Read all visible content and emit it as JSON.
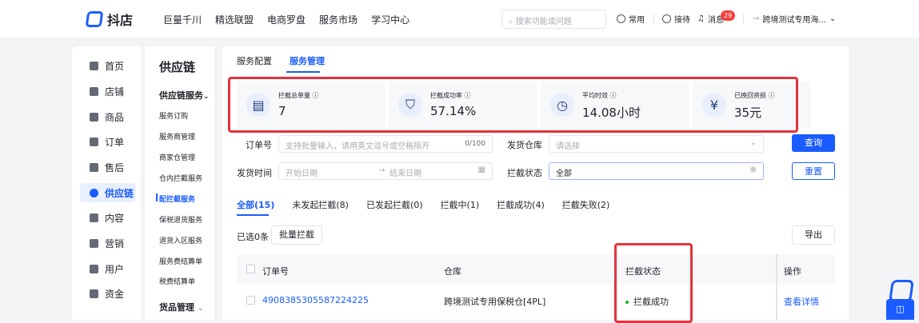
{
  "brand": {
    "name": "抖店"
  },
  "topnav": [
    "巨量千川",
    "精选联盟",
    "电商罗盘",
    "服务市场",
    "学习中心"
  ],
  "search": {
    "placeholder": "搜索功能或问题"
  },
  "toolbar": {
    "common": "常用",
    "service": "接待",
    "messages": "消息",
    "msg_count": "29",
    "shop": "跨境测试专用海..."
  },
  "sidebar": [
    {
      "label": "首页",
      "icon": "home-icon"
    },
    {
      "label": "店铺",
      "icon": "store-icon"
    },
    {
      "label": "商品",
      "icon": "product-icon"
    },
    {
      "label": "订单",
      "icon": "order-icon"
    },
    {
      "label": "售后",
      "icon": "aftersale-icon"
    },
    {
      "label": "供应链",
      "icon": "supply-chain-icon",
      "active": true
    },
    {
      "label": "内容",
      "icon": "content-icon"
    },
    {
      "label": "营销",
      "icon": "marketing-icon"
    },
    {
      "label": "用户",
      "icon": "user-icon"
    },
    {
      "label": "资金",
      "icon": "finance-icon"
    }
  ],
  "submenu": {
    "title": "供应链",
    "group1": "供应链服务",
    "items": [
      "服务订购",
      "服务商管理",
      "商家仓管理",
      "仓内拦截服务",
      "配拦截服务",
      "保税退货服务",
      "退货入区服务",
      "服务费结算单",
      "税费结算单"
    ],
    "group2": "货品管理"
  },
  "page_tabs": [
    "服务配置",
    "服务管理"
  ],
  "stats": [
    {
      "label": "拦截总单量",
      "value": "7",
      "icon": "intercept-total-icon",
      "glyph": "▤"
    },
    {
      "label": "拦截成功率",
      "value": "57.14%",
      "icon": "success-rate-icon",
      "glyph": "⛉"
    },
    {
      "label": "平均时效",
      "value": "14.08小时",
      "icon": "clock-icon",
      "glyph": "◷"
    },
    {
      "label": "已挽回资损",
      "value": "35元",
      "icon": "refund-icon",
      "glyph": "¥"
    }
  ],
  "filters": {
    "order_label": "订单号",
    "order_placeholder": "支持批量输入，请用英文逗号或空格隔开",
    "order_counter": "0/100",
    "warehouse_label": "发货仓库",
    "warehouse_placeholder": "请选择",
    "date_label": "发货时间",
    "date_start": "开始日期",
    "date_sep": "→",
    "date_end": "结束日期",
    "status_label": "拦截状态",
    "status_value": "全部",
    "query": "查询",
    "reset": "重置"
  },
  "status_tabs": [
    "全部(15)",
    "未发起拦截(8)",
    "已发起拦截(0)",
    "拦截中(1)",
    "拦截成功(4)",
    "拦截失败(2)"
  ],
  "bulk": {
    "selected": "已选0条",
    "bulk_intercept": "批量拦截",
    "export": "导出"
  },
  "table": {
    "headers": [
      "订单号",
      "仓库",
      "拦截状态",
      "操作"
    ],
    "rows": [
      {
        "order": "4908385305587224225",
        "warehouse": "跨境测试专用保税仓[4PL]",
        "status": "拦截成功",
        "action": "查看详情"
      }
    ]
  },
  "float_button": "◫"
}
